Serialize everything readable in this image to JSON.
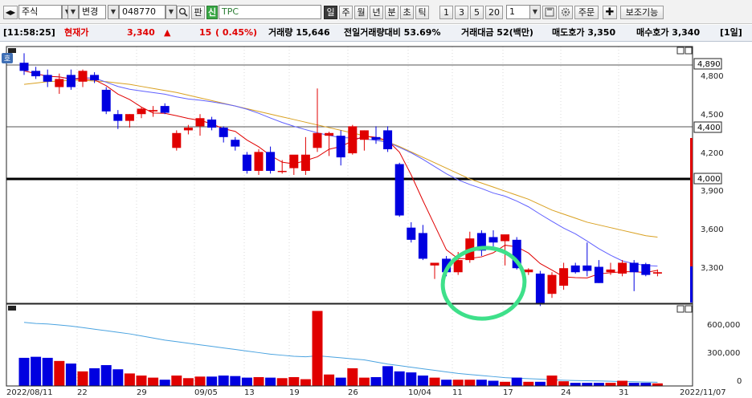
{
  "toolbar": {
    "market": "주식",
    "change_label": "변경",
    "code": "048770",
    "hangul_btn": "판",
    "credit_badge": "신",
    "stock_name": "TPC",
    "periods": [
      "일",
      "주",
      "월",
      "년",
      "분",
      "초",
      "틱"
    ],
    "intervals": [
      "1",
      "3",
      "5",
      "20"
    ],
    "count": "1",
    "order_btn": "주문",
    "indicators_btn": "보조기능"
  },
  "info": {
    "time": "[11:58:25]",
    "price_label": "현재가",
    "price": "3,340",
    "arrow": "▲",
    "change": "15",
    "change_pct": "( 0.45%)",
    "volume": "거래량 15,646",
    "prev_vol": "전일거래량대비 53.69%",
    "amount": "거래대금 52(백만)",
    "ask": "매도호가 3,350",
    "bid": "매수호가 3,340",
    "period": "[1일]"
  },
  "chart": {
    "price_badge": "호",
    "price_axis": [
      "4,800",
      "4,500",
      "4,200",
      "3,900",
      "3,600",
      "3,300"
    ],
    "hlines": [
      "4,890",
      "4,400",
      "4,000"
    ],
    "volume_axis": [
      "600,000",
      "300,000",
      "0"
    ],
    "date_axis": [
      "2022/08/11",
      "22",
      "29",
      "09/05",
      "13",
      "19",
      "26",
      "10/04",
      "11",
      "17",
      "24",
      "31",
      "2022/11/07"
    ]
  },
  "chart_data": {
    "type": "candlestick",
    "price_range": [
      3100,
      5000
    ],
    "volume_range": [
      0,
      770000
    ],
    "colors": {
      "up": "#e00000",
      "down": "#0000e0",
      "ma5": "#e00000",
      "ma20": "#6060ff",
      "ma60": "#d9a020",
      "volume_line": "#4aa3e0"
    },
    "ohlc": [
      [
        4880,
        4950,
        4790,
        4820
      ],
      [
        4820,
        4850,
        4760,
        4780
      ],
      [
        4790,
        4830,
        4700,
        4740
      ],
      [
        4700,
        4800,
        4650,
        4760
      ],
      [
        4790,
        4830,
        4680,
        4700
      ],
      [
        4740,
        4830,
        4700,
        4820
      ],
      [
        4790,
        4810,
        4730,
        4750
      ],
      [
        4680,
        4700,
        4500,
        4520
      ],
      [
        4500,
        4530,
        4390,
        4450
      ],
      [
        4450,
        4500,
        4400,
        4500
      ],
      [
        4500,
        4550,
        4470,
        4540
      ],
      [
        4520,
        4560,
        4480,
        4530
      ],
      [
        4560,
        4580,
        4500,
        4510
      ],
      [
        4250,
        4380,
        4230,
        4360
      ],
      [
        4380,
        4420,
        4350,
        4400
      ],
      [
        4410,
        4500,
        4340,
        4470
      ],
      [
        4460,
        4480,
        4380,
        4400
      ],
      [
        4400,
        4410,
        4290,
        4330
      ],
      [
        4310,
        4330,
        4230,
        4260
      ],
      [
        4200,
        4220,
        4060,
        4080
      ],
      [
        4080,
        4240,
        4050,
        4220
      ],
      [
        4220,
        4260,
        4060,
        4080
      ],
      [
        4080,
        4160,
        4060,
        4080
      ],
      [
        4100,
        4160,
        4050,
        4200
      ],
      [
        4080,
        4330,
        4050,
        4200
      ],
      [
        4250,
        4690,
        4220,
        4360
      ],
      [
        4340,
        4370,
        4190,
        4360
      ],
      [
        4340,
        4380,
        4120,
        4180
      ],
      [
        4210,
        4420,
        4200,
        4410
      ],
      [
        4310,
        4380,
        4230,
        4380
      ],
      [
        4330,
        4410,
        4280,
        4310
      ],
      [
        4380,
        4410,
        4220,
        4240
      ],
      [
        4130,
        4140,
        3740,
        3750
      ],
      [
        3660,
        3700,
        3550,
        3570
      ],
      [
        3620,
        3680,
        3420,
        3430
      ],
      [
        3380,
        3400,
        3280,
        3400
      ],
      [
        3430,
        3450,
        3300,
        3330
      ],
      [
        3330,
        3480,
        3310,
        3420
      ],
      [
        3420,
        3630,
        3400,
        3580
      ],
      [
        3620,
        3640,
        3450,
        3490
      ],
      [
        3590,
        3640,
        3520,
        3550
      ],
      [
        3560,
        3600,
        3380,
        3610
      ],
      [
        3570,
        3590,
        3350,
        3360
      ],
      [
        3330,
        3360,
        3310,
        3350
      ],
      [
        3320,
        3340,
        3080,
        3100
      ],
      [
        3170,
        3330,
        3140,
        3310
      ],
      [
        3230,
        3400,
        3200,
        3360
      ],
      [
        3380,
        3400,
        3320,
        3330
      ],
      [
        3380,
        3550,
        3300,
        3340
      ],
      [
        3370,
        3420,
        3250,
        3250
      ],
      [
        3330,
        3400,
        3310,
        3350
      ],
      [
        3320,
        3420,
        3300,
        3400
      ],
      [
        3400,
        3420,
        3190,
        3330
      ],
      [
        3390,
        3400,
        3300,
        3310
      ],
      [
        3320,
        3350,
        3300,
        3330
      ]
    ],
    "volume": [
      270000,
      280000,
      270000,
      240000,
      215000,
      140000,
      170000,
      200000,
      160000,
      120000,
      100000,
      80000,
      60000,
      100000,
      75000,
      90000,
      90000,
      100000,
      95000,
      80000,
      85000,
      80000,
      75000,
      85000,
      65000,
      720000,
      110000,
      80000,
      170000,
      80000,
      85000,
      190000,
      140000,
      130000,
      100000,
      80000,
      60000,
      60000,
      60000,
      60000,
      50000,
      40000,
      80000,
      40000,
      40000,
      100000,
      45000,
      30000,
      30000,
      30000,
      30000,
      50000,
      30000,
      30000,
      25000
    ],
    "volume_line": [
      610000,
      600000,
      595000,
      585000,
      575000,
      560000,
      545000,
      530000,
      515000,
      500000,
      480000,
      460000,
      440000,
      425000,
      410000,
      395000,
      380000,
      365000,
      350000,
      335000,
      320000,
      305000,
      295000,
      285000,
      280000,
      290000,
      280000,
      270000,
      260000,
      250000,
      230000,
      210000,
      195000,
      180000,
      165000,
      150000,
      135000,
      120000,
      110000,
      100000,
      90000,
      80000,
      75000,
      70000,
      65000,
      60000,
      55000,
      52000,
      50000,
      48000,
      45000,
      42000,
      40000,
      38000,
      36000
    ]
  }
}
